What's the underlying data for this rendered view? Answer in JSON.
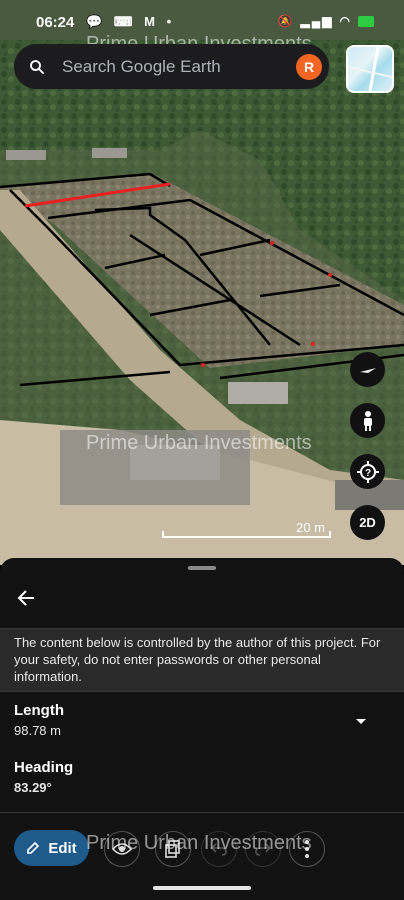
{
  "status_bar": {
    "time": "06:24",
    "left_icons": "💬 ⌨ M •",
    "right_icons": "🔕 ⋯ R ◔"
  },
  "watermark": {
    "text": "Prime Urban Investments"
  },
  "search": {
    "placeholder": "Search Google Earth",
    "avatar_letter": "R"
  },
  "map": {
    "scale_label": "20 m",
    "view_mode_label": "2D",
    "colors": {
      "boundary": "#000000",
      "highlight": "#e82020",
      "vegetation": "#3d5a33",
      "soil": "#a89a82"
    }
  },
  "sheet": {
    "notice": "The content below is controlled by the author of this project. For your safety, do not enter passwords or other personal information.",
    "length": {
      "label": "Length",
      "value": "98.78 m"
    },
    "heading": {
      "label": "Heading",
      "value": "83.29°"
    }
  },
  "toolbar": {
    "edit_label": "Edit"
  },
  "accent": "#1f5b8a"
}
